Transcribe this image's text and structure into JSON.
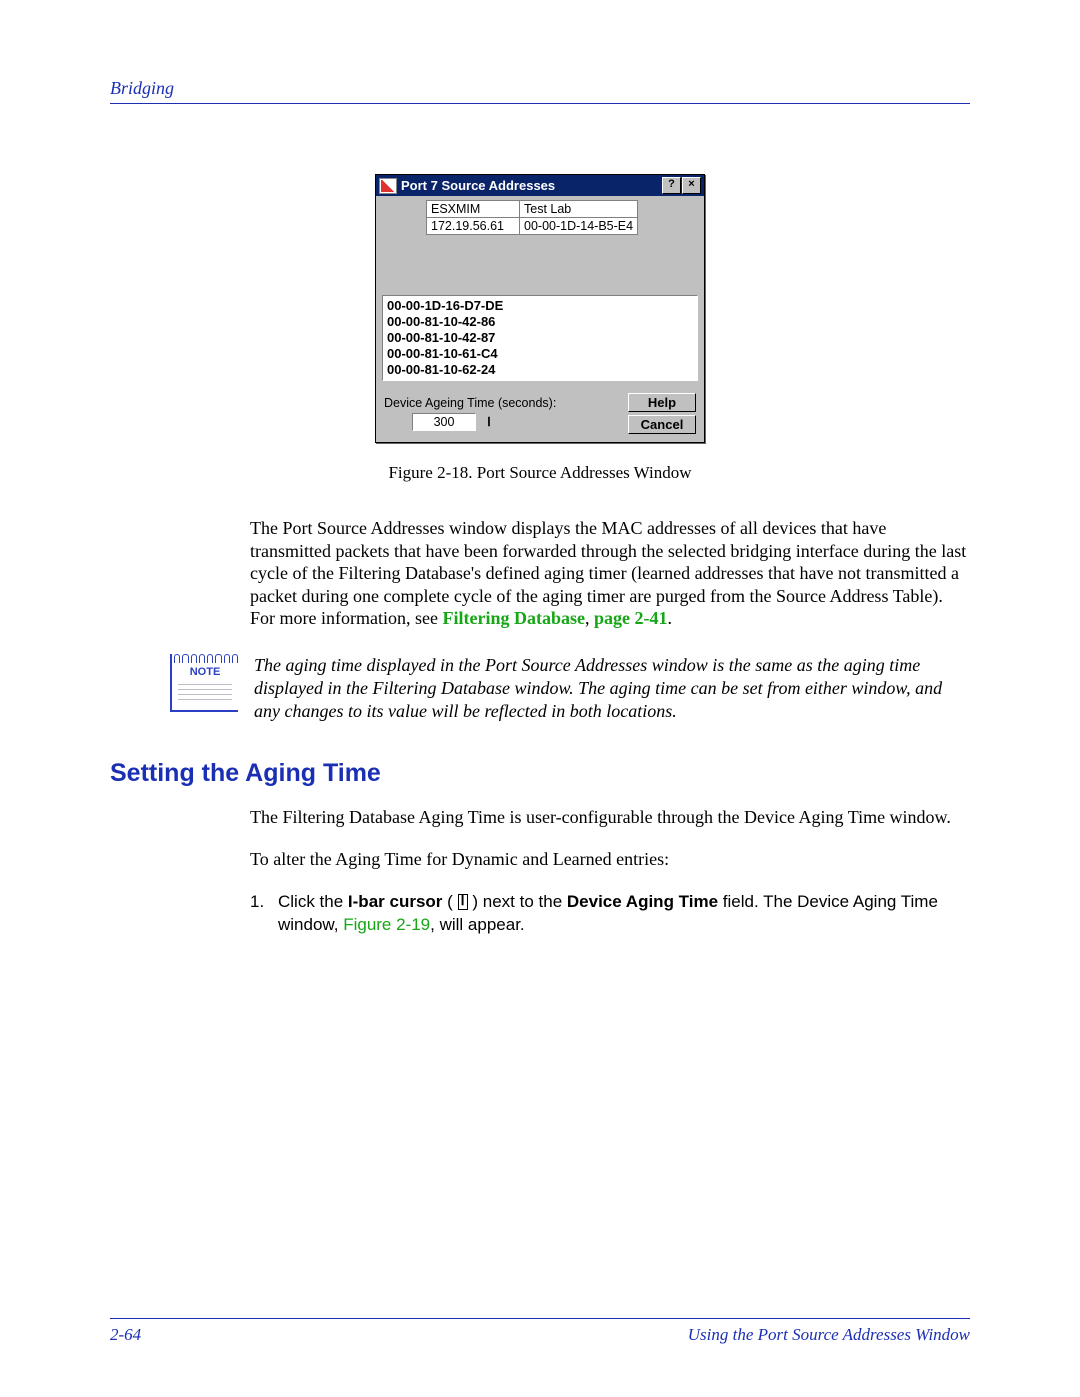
{
  "header": {
    "section": "Bridging"
  },
  "dialog": {
    "title": "Port 7 Source Addresses",
    "help_glyph": "?",
    "close_glyph": "×",
    "info": {
      "name": "ESXMIM",
      "location": "Test Lab",
      "ip": "172.19.56.61",
      "mac": "00-00-1D-14-B5-E4"
    },
    "mac_list": [
      "00-00-1D-16-D7-DE",
      "00-00-81-10-42-86",
      "00-00-81-10-42-87",
      "00-00-81-10-61-C4",
      "00-00-81-10-62-24"
    ],
    "ageing_label": "Device Ageing Time (seconds):",
    "ageing_value": "300",
    "help_btn": "Help",
    "cancel_btn": "Cancel"
  },
  "figure_caption": "Figure 2-18. Port Source Addresses Window",
  "para1": "The Port Source Addresses window displays the MAC addresses of all devices that have transmitted packets that have been forwarded through the selected bridging interface during the last cycle of the Filtering Database's defined aging timer (learned addresses that have not transmitted a packet during one complete cycle of the aging timer are purged from the Source Address Table). For more information, see ",
  "para1_xref": "Filtering Database",
  "para1_tail": ", ",
  "para1_page": "page 2-41",
  "para1_end": ".",
  "note_label": "NOTE",
  "note_text": "The aging time displayed in the Port Source Addresses window is the same as the aging time displayed in the Filtering Database window. The aging time can be set from either window, and any changes to its value will be reflected in both locations.",
  "heading": "Setting the Aging Time",
  "para2": "The Filtering Database Aging Time is user-configurable through the Device Aging Time window.",
  "para3": "To alter the Aging Time for Dynamic and Learned entries:",
  "step": {
    "num": "1.",
    "t1": "Click the ",
    "b1": "I-bar cursor",
    "t2": " ( ",
    "t3": " ) next to the ",
    "b2": "Device Aging Time",
    "t4": " field. The Device Aging Time window, ",
    "xref": "Figure 2-19",
    "t5": ", will appear."
  },
  "footer": {
    "page": "2-64",
    "title": "Using the Port Source Addresses Window"
  }
}
